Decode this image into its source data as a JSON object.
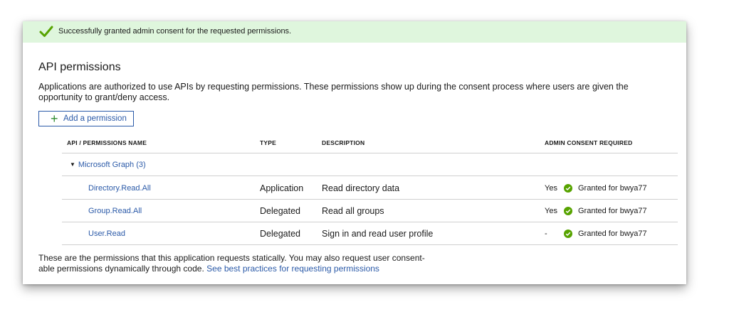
{
  "banner": {
    "message": "Successfully granted admin consent for the requested permissions."
  },
  "page": {
    "title": "API permissions",
    "description": "Applications are authorized to use APIs by requesting permissions. These permissions show up during the consent process where users are given the opportunity to grant/deny access."
  },
  "toolbar": {
    "add_permission_label": "Add a permission"
  },
  "table": {
    "columns": [
      "API / PERMISSIONS NAME",
      "TYPE",
      "DESCRIPTION",
      "ADMIN CONSENT REQUIRED"
    ],
    "group": {
      "label": "Microsoft Graph (3)"
    },
    "rows": [
      {
        "name": "Directory.Read.All",
        "type": "Application",
        "description": "Read directory data",
        "admin_consent": "Yes",
        "status": "Granted for bwya77"
      },
      {
        "name": "Group.Read.All",
        "type": "Delegated",
        "description": "Read all groups",
        "admin_consent": "Yes",
        "status": "Granted for bwya77"
      },
      {
        "name": "User.Read",
        "type": "Delegated",
        "description": "Sign in and read user profile",
        "admin_consent": "-",
        "status": "Granted for bwya77"
      }
    ]
  },
  "footer": {
    "text": "These are the permissions that this application requests statically. You may also request user consent-able permissions dynamically through code.",
    "link": "See best practices for requesting permissions"
  },
  "colors": {
    "banner_bg": "#dff6dd",
    "success_green": "#57a300",
    "link_blue": "#2b5aa8"
  }
}
